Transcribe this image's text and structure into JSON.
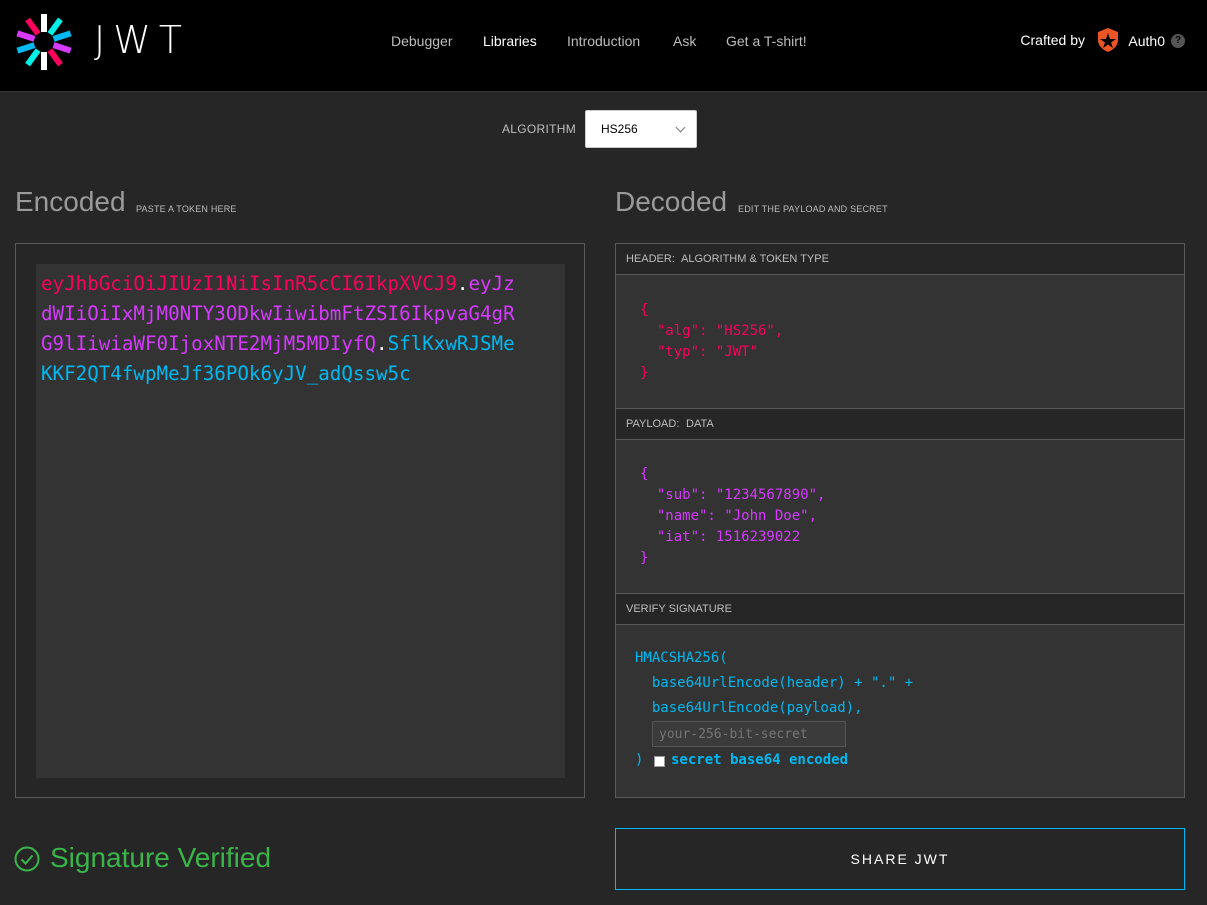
{
  "header": {
    "logo_text": "JWT",
    "nav": [
      "Debugger",
      "Libraries",
      "Introduction",
      "Ask",
      "Get a T-shirt!"
    ],
    "active_nav": "Libraries",
    "crafted_by": "Crafted by",
    "brand": "Auth0",
    "help": "?"
  },
  "algorithm": {
    "label": "ALGORITHM",
    "value": "HS256"
  },
  "encoded": {
    "title": "Encoded",
    "subtitle": "PASTE A TOKEN HERE",
    "token_header": "eyJhbGciOiJIUzI1NiIsInR5cCI6IkpXVCJ9",
    "token_payload": "eyJzdWIiOiIxMjM0NTY3ODkwIiwibmFtZSI6IkpvaG4gRG9lIiwiaWF0IjoxNTE2MjM5MDIyfQ",
    "token_signature": "SflKxwRJSMeKKF2QT4fwpMeJf36POk6yJV_adQssw5c",
    "dot": "."
  },
  "decoded": {
    "title": "Decoded",
    "subtitle": "EDIT THE PAYLOAD AND SECRET",
    "header_section": {
      "label": "HEADER:",
      "desc": "ALGORITHM & TOKEN TYPE",
      "lines": [
        "{",
        "  \"alg\": \"HS256\",",
        "  \"typ\": \"JWT\"",
        "}"
      ]
    },
    "payload_section": {
      "label": "PAYLOAD:",
      "desc": "DATA",
      "lines": [
        "{",
        "  \"sub\": \"1234567890\",",
        "  \"name\": \"John Doe\",",
        "  \"iat\": 1516239022",
        "}"
      ]
    },
    "signature_section": {
      "label": "VERIFY SIGNATURE",
      "lines": [
        "HMACSHA256(",
        "  base64UrlEncode(header) + \".\" +",
        "  base64UrlEncode(payload),"
      ],
      "secret_placeholder": "your-256-bit-secret",
      "close_paren": ")",
      "checkbox_label": "secret base64 encoded"
    }
  },
  "status": {
    "text": "Signature Verified",
    "color": "#3ab54a"
  },
  "share_button": "SHARE JWT",
  "colors": {
    "header": "#fb015b",
    "payload": "#d63aff",
    "signature": "#00b9f1"
  }
}
